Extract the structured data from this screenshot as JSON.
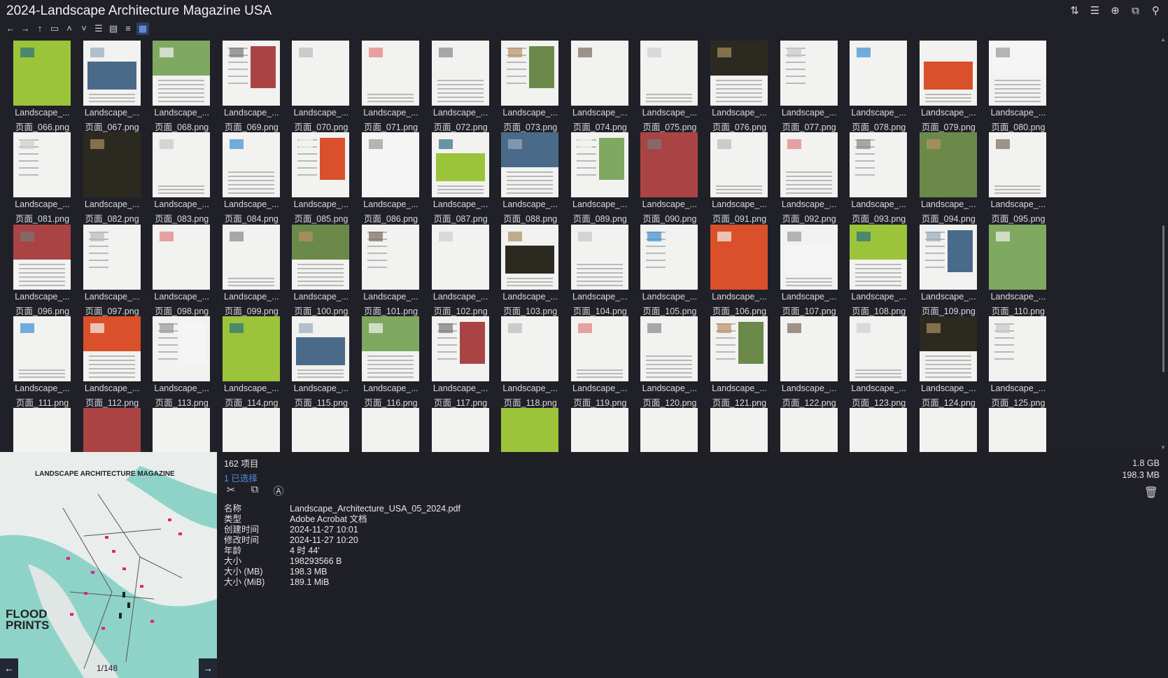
{
  "window": {
    "title": "2024-Landscape Architecture Magazine USA"
  },
  "top_icons": [
    "sort-icon",
    "list-icon",
    "add-icon",
    "copy-icon",
    "pin-icon"
  ],
  "toolbar": {
    "buttons": [
      "back-icon",
      "forward-icon",
      "up-icon",
      "folder-icon",
      "chevron-up-icon",
      "chevron-down-icon",
      "list-view-icon",
      "details-view-icon",
      "tree-view-icon",
      "thumbnail-view-icon"
    ],
    "active": "thumbnail-view-icon"
  },
  "files": {
    "name_prefix": "Landscape_...",
    "items": [
      "页面_066.png",
      "页面_067.png",
      "页面_068.png",
      "页面_069.png",
      "页面_070.png",
      "页面_071.png",
      "页面_072.png",
      "页面_073.png",
      "页面_074.png",
      "页面_075.png",
      "页面_076.png",
      "页面_077.png",
      "页面_078.png",
      "页面_079.png",
      "页面_080.png",
      "页面_081.png",
      "页面_082.png",
      "页面_083.png",
      "页面_084.png",
      "页面_085.png",
      "页面_086.png",
      "页面_087.png",
      "页面_088.png",
      "页面_089.png",
      "页面_090.png",
      "页面_091.png",
      "页面_092.png",
      "页面_093.png",
      "页面_094.png",
      "页面_095.png",
      "页面_096.png",
      "页面_097.png",
      "页面_098.png",
      "页面_099.png",
      "页面_100.png",
      "页面_101.png",
      "页面_102.png",
      "页面_103.png",
      "页面_104.png",
      "页面_105.png",
      "页面_106.png",
      "页面_107.png",
      "页面_108.png",
      "页面_109.png",
      "页面_110.png",
      "页面_111.png",
      "页面_112.png",
      "页面_113.png",
      "页面_114.png",
      "页面_115.png",
      "页面_116.png",
      "页面_117.png",
      "页面_118.png",
      "页面_119.png",
      "页面_120.png",
      "页面_121.png",
      "页面_122.png",
      "页面_123.png",
      "页面_124.png",
      "页面_125.png"
    ]
  },
  "status": {
    "count": "162 项目",
    "selected": "1 已选择",
    "disk_total": "1.8 GB",
    "selected_size": "198.3 MB"
  },
  "details": {
    "rows": [
      {
        "key": "名称",
        "value": "Landscape_Architecture_USA_05_2024.pdf"
      },
      {
        "key": "类型",
        "value": "Adobe Acrobat 文档"
      },
      {
        "key": "创建时间",
        "value": "2024-11-27  10:01"
      },
      {
        "key": "修改时间",
        "value": "2024-11-27  10:20"
      },
      {
        "key": "年龄",
        "value": "4 时 44'"
      },
      {
        "key": "大小",
        "value": "198293566 B"
      },
      {
        "key": "大小 (MB)",
        "value": "198.3 MB"
      },
      {
        "key": "大小 (MiB)",
        "value": "189.1 MiB"
      }
    ]
  },
  "preview": {
    "magazine_title": "LANDSCAPE ARCHITECTURE MAGAZINE",
    "headline": "FLOOD\nPRINTS",
    "page_indicator": "1/148"
  }
}
